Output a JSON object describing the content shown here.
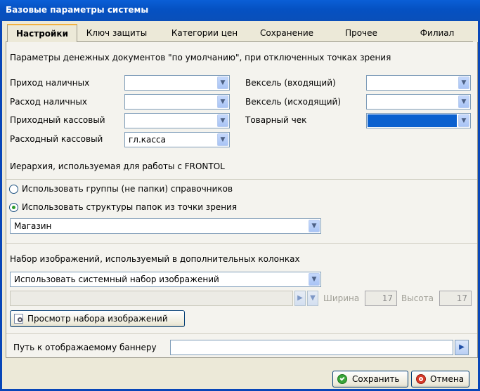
{
  "window": {
    "title": "Базовые параметры системы"
  },
  "tabs": [
    {
      "label": "Настройки",
      "active": true
    },
    {
      "label": "Ключ защиты"
    },
    {
      "label": "Категории цен"
    },
    {
      "label": "Сохранение"
    },
    {
      "label": "Прочее"
    },
    {
      "label": "Филиал"
    }
  ],
  "money_docs": {
    "heading": "Параметры денежных документов \"по умолчанию\", при отключенных точках зрения",
    "left": [
      {
        "label": "Приход наличных",
        "value": ""
      },
      {
        "label": "Расход наличных",
        "value": ""
      },
      {
        "label": "Приходный кассовый",
        "value": ""
      },
      {
        "label": "Расходный кассовый",
        "value": "гл.касса"
      }
    ],
    "right": [
      {
        "label": "Вексель (входящий)",
        "value": ""
      },
      {
        "label": "Вексель (исходящий)",
        "value": ""
      },
      {
        "label": "Товарный чек",
        "value": ""
      }
    ]
  },
  "hierarchy": {
    "heading": "Иерархия, используемая для работы с FRONTOL",
    "option_groups": "Использовать группы (не папки)  справочников",
    "option_folders": "Использовать структуры папок из точки зрения",
    "selected": "option_folders",
    "viewpoint_value": "Магазин"
  },
  "images": {
    "heading": "Набор изображений, используемый в дополнительных колонках",
    "set_value": "Использовать системный набор изображений",
    "width_label": "Ширина",
    "width_value": "17",
    "height_label": "Высота",
    "height_value": "17",
    "preview_button": "Просмотр набора изображений"
  },
  "banner": {
    "label": "Путь к отображаемому баннеру",
    "value": ""
  },
  "footer": {
    "save": "Сохранить",
    "cancel": "Отмена"
  },
  "colors": {
    "title_bar": "#0a5fd6",
    "selection": "#0b61cf",
    "active_tab_accent": "#f2b13e"
  }
}
